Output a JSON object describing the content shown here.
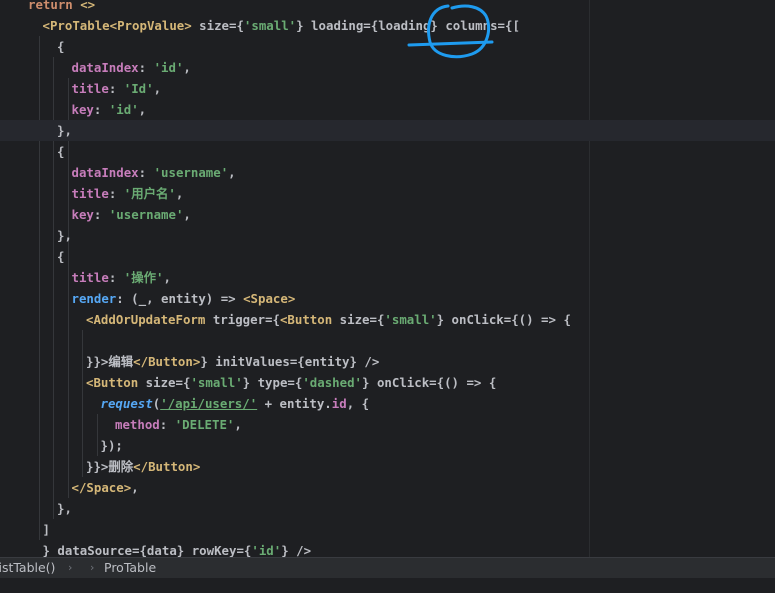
{
  "code_lines": [
    {
      "indent": 0,
      "tokens": [
        {
          "t": "return",
          "c": "kw"
        },
        {
          "t": " <>",
          "c": "tag"
        }
      ]
    },
    {
      "indent": 1,
      "tokens": [
        {
          "t": "<ProTable",
          "c": "tag"
        },
        {
          "t": "<PropValue>",
          "c": "tag"
        },
        {
          "t": " size={",
          "c": "punc"
        },
        {
          "t": "'small'",
          "c": "str"
        },
        {
          "t": "} loading={loading} columns={[",
          "c": "punc"
        }
      ]
    },
    {
      "indent": 2,
      "tokens": [
        {
          "t": "{",
          "c": "punc"
        }
      ]
    },
    {
      "indent": 3,
      "tokens": [
        {
          "t": "dataIndex",
          "c": "prop"
        },
        {
          "t": ": ",
          "c": "punc"
        },
        {
          "t": "'id'",
          "c": "str"
        },
        {
          "t": ",",
          "c": "punc"
        }
      ]
    },
    {
      "indent": 3,
      "tokens": [
        {
          "t": "title",
          "c": "prop"
        },
        {
          "t": ": ",
          "c": "punc"
        },
        {
          "t": "'Id'",
          "c": "str"
        },
        {
          "t": ",",
          "c": "punc"
        }
      ]
    },
    {
      "indent": 3,
      "tokens": [
        {
          "t": "key",
          "c": "prop"
        },
        {
          "t": ": ",
          "c": "punc"
        },
        {
          "t": "'id'",
          "c": "str"
        },
        {
          "t": ",",
          "c": "punc"
        }
      ]
    },
    {
      "indent": 2,
      "tokens": [
        {
          "t": "},",
          "c": "punc"
        }
      ],
      "current": true
    },
    {
      "indent": 2,
      "tokens": [
        {
          "t": "{",
          "c": "punc"
        }
      ]
    },
    {
      "indent": 3,
      "tokens": [
        {
          "t": "dataIndex",
          "c": "prop"
        },
        {
          "t": ": ",
          "c": "punc"
        },
        {
          "t": "'username'",
          "c": "str"
        },
        {
          "t": ",",
          "c": "punc"
        }
      ]
    },
    {
      "indent": 3,
      "tokens": [
        {
          "t": "title",
          "c": "prop"
        },
        {
          "t": ": ",
          "c": "punc"
        },
        {
          "t": "'用户名'",
          "c": "str"
        },
        {
          "t": ",",
          "c": "punc"
        }
      ]
    },
    {
      "indent": 3,
      "tokens": [
        {
          "t": "key",
          "c": "prop"
        },
        {
          "t": ": ",
          "c": "punc"
        },
        {
          "t": "'username'",
          "c": "str"
        },
        {
          "t": ",",
          "c": "punc"
        }
      ]
    },
    {
      "indent": 2,
      "tokens": [
        {
          "t": "},",
          "c": "punc"
        }
      ]
    },
    {
      "indent": 2,
      "tokens": [
        {
          "t": "{",
          "c": "punc"
        }
      ]
    },
    {
      "indent": 3,
      "tokens": [
        {
          "t": "title",
          "c": "prop"
        },
        {
          "t": ": ",
          "c": "punc"
        },
        {
          "t": "'操作'",
          "c": "str"
        },
        {
          "t": ",",
          "c": "punc"
        }
      ]
    },
    {
      "indent": 3,
      "tokens": [
        {
          "t": "render",
          "c": "fn-plain"
        },
        {
          "t": ": (_, entity) => ",
          "c": "punc"
        },
        {
          "t": "<Space>",
          "c": "tag"
        }
      ]
    },
    {
      "indent": 4,
      "tokens": [
        {
          "t": "<AddOrUpdateForm",
          "c": "tag"
        },
        {
          "t": " trigger={",
          "c": "punc"
        },
        {
          "t": "<Button",
          "c": "tag"
        },
        {
          "t": " size={",
          "c": "punc"
        },
        {
          "t": "'small'",
          "c": "str"
        },
        {
          "t": "} onClick={() => {",
          "c": "punc"
        }
      ]
    },
    {
      "indent": 4,
      "tokens": []
    },
    {
      "indent": 4,
      "tokens": [
        {
          "t": "}}>编辑",
          "c": "punc"
        },
        {
          "t": "</Button>",
          "c": "tag"
        },
        {
          "t": "} initValues={entity} />",
          "c": "punc"
        }
      ]
    },
    {
      "indent": 4,
      "tokens": [
        {
          "t": "<Button",
          "c": "tag"
        },
        {
          "t": " size={",
          "c": "punc"
        },
        {
          "t": "'small'",
          "c": "str"
        },
        {
          "t": "} type={",
          "c": "punc"
        },
        {
          "t": "'dashed'",
          "c": "str"
        },
        {
          "t": "} onClick={() => {",
          "c": "punc"
        }
      ]
    },
    {
      "indent": 5,
      "tokens": [
        {
          "t": "request",
          "c": "fn"
        },
        {
          "t": "(",
          "c": "punc"
        },
        {
          "t": "'/api/users/'",
          "c": "link"
        },
        {
          "t": " + entity.",
          "c": "punc"
        },
        {
          "t": "id",
          "c": "num-field"
        },
        {
          "t": ", {",
          "c": "punc"
        }
      ]
    },
    {
      "indent": 6,
      "tokens": [
        {
          "t": "method",
          "c": "prop"
        },
        {
          "t": ": ",
          "c": "punc"
        },
        {
          "t": "'DELETE'",
          "c": "str"
        },
        {
          "t": ",",
          "c": "punc"
        }
      ]
    },
    {
      "indent": 5,
      "tokens": [
        {
          "t": "});",
          "c": "punc"
        }
      ]
    },
    {
      "indent": 4,
      "tokens": [
        {
          "t": "}}>删除",
          "c": "punc"
        },
        {
          "t": "</Button>",
          "c": "tag"
        }
      ]
    },
    {
      "indent": 3,
      "tokens": [
        {
          "t": "</Space>",
          "c": "tag"
        },
        {
          "t": ",",
          "c": "punc"
        }
      ]
    },
    {
      "indent": 2,
      "tokens": [
        {
          "t": "},",
          "c": "punc"
        }
      ]
    },
    {
      "indent": 1,
      "tokens": [
        {
          "t": "]",
          "c": "punc"
        }
      ]
    },
    {
      "indent": 1,
      "tokens": [
        {
          "t": "} dataSource={data} rowKey={",
          "c": "punc"
        },
        {
          "t": "'id'",
          "c": "str"
        },
        {
          "t": "} />",
          "c": "punc"
        }
      ]
    }
  ],
  "breadcrumb": {
    "items": [
      "listTable()",
      "ProTable"
    ]
  },
  "colors": {
    "annotation": "#1e9bef"
  }
}
